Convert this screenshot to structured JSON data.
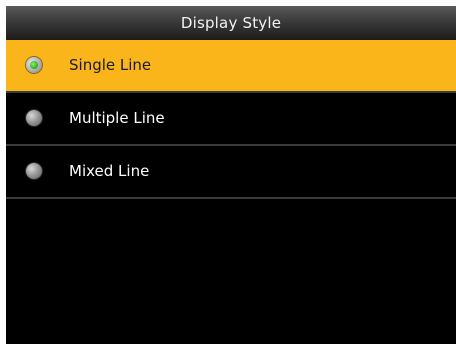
{
  "header": {
    "title": "Display Style"
  },
  "options": [
    {
      "label": "Single Line",
      "selected": true
    },
    {
      "label": "Multiple Line",
      "selected": false
    },
    {
      "label": "Mixed Line",
      "selected": false
    }
  ],
  "colors": {
    "selected_background": "#fab51b",
    "screen_background": "#000000",
    "radio_selected_dot": "#33b51f"
  }
}
